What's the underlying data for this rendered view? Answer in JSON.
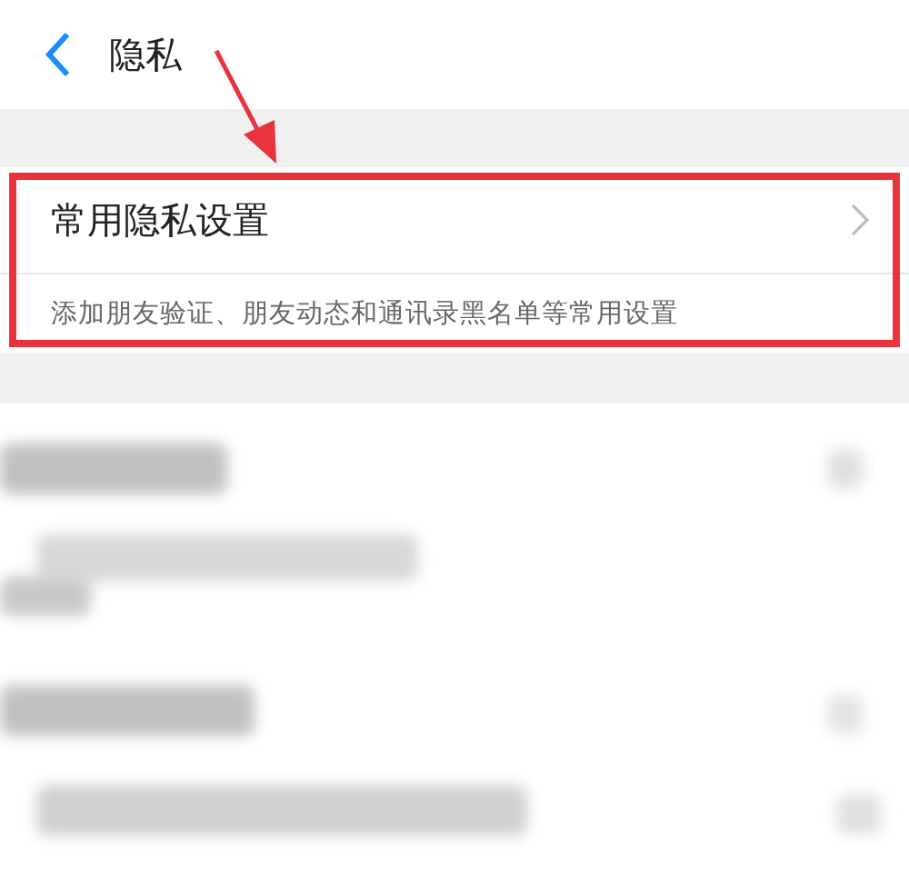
{
  "header": {
    "title": "隐私"
  },
  "privacy_section": {
    "title": "常用隐私设置",
    "description": "添加朋友验证、朋友动态和通讯录黑名单等常用设置"
  }
}
